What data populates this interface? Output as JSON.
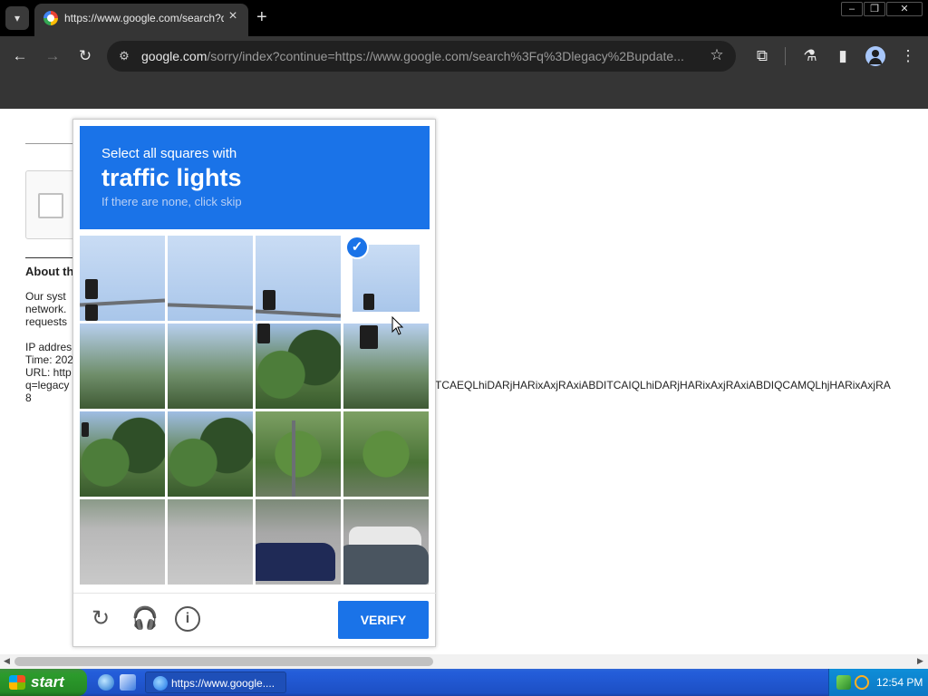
{
  "browser": {
    "tab": {
      "title": "https://www.google.com/search?q"
    },
    "omnibox": {
      "host": "google.com",
      "path": "/sorry/index?continue=https://www.google.com/search%3Fq%3Dlegacy%2Bupdate..."
    }
  },
  "page": {
    "about_title": "About th",
    "about_text": "Our syst\nnetwork.\nrequests\n\nIP addres\nTime: 202\nURL: http\nq=legacy\n8",
    "long_line": "TCAEQLhiDARjHARixAxjRAxiABDITCAIQLhiDARjHARixAxjRAxiABDIQCAMQLhjHARixAxjRA"
  },
  "challenge": {
    "instruction_line1": "Select all squares with",
    "instruction_target": "traffic lights",
    "instruction_line3": "If there are none, click skip",
    "verify_label": "VERIFY",
    "selected_tiles": [
      3
    ]
  },
  "taskbar": {
    "start_label": "start",
    "task_label": "https://www.google....",
    "clock": "12:54 PM"
  },
  "icons": {
    "reload": "reload-icon",
    "audio": "headphones-icon",
    "info": "info-icon"
  },
  "colors": {
    "accent": "#1a73e8",
    "browser_dark": "#353535"
  }
}
